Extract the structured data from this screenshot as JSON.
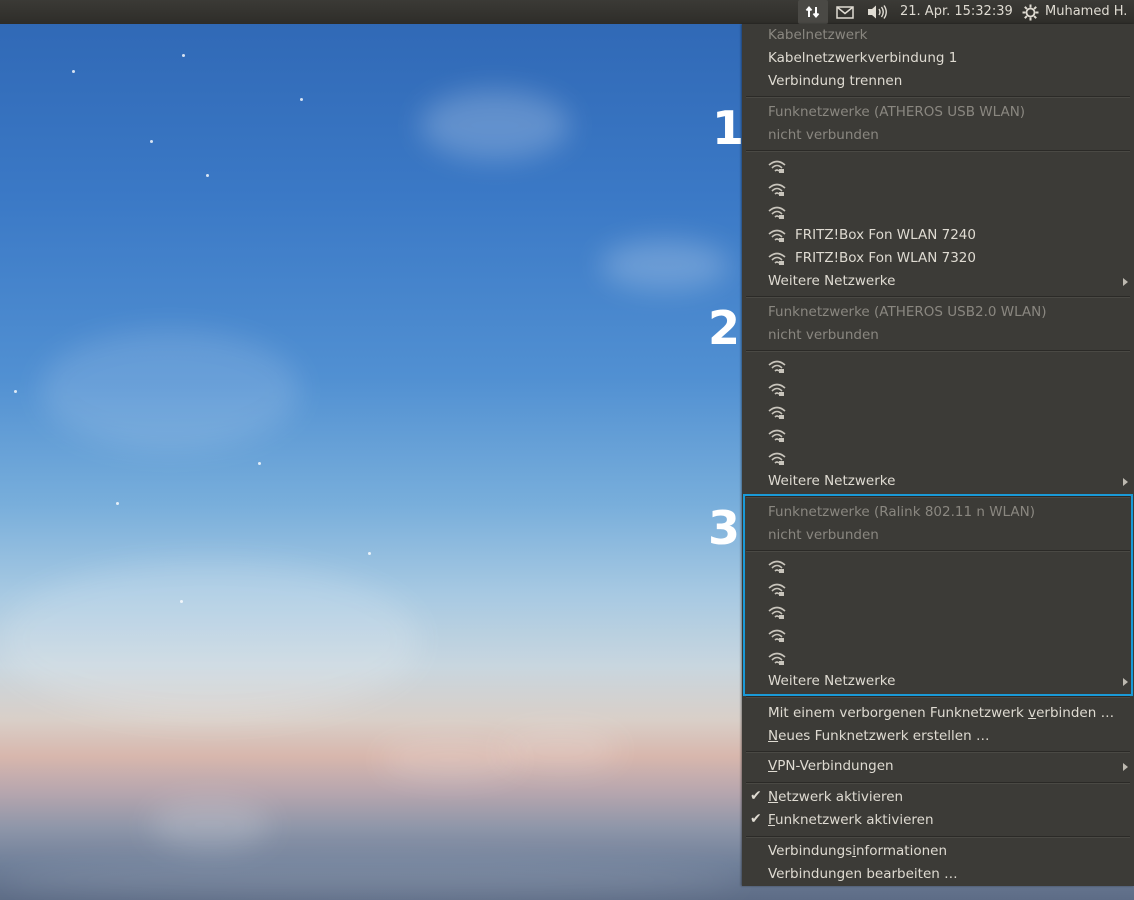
{
  "panel": {
    "clock": "21. Apr. 15:32:39",
    "user": "Muhamed H."
  },
  "annotations": [
    "1",
    "2",
    "3"
  ],
  "menu": {
    "wired": {
      "header": "Kabelnetzwerk",
      "connection": "Kabelnetzwerkverbindung 1",
      "disconnect": "Verbindung trennen"
    },
    "wifi1": {
      "header": "Funknetzwerke (ATHEROS USB WLAN)",
      "status": "nicht verbunden",
      "networks": [
        "",
        "",
        "",
        "FRITZ!Box Fon WLAN 7240",
        "FRITZ!Box Fon WLAN 7320"
      ],
      "more": "Weitere Netzwerke"
    },
    "wifi2": {
      "header": "Funknetzwerke (ATHEROS USB2.0 WLAN)",
      "status": "nicht verbunden",
      "networks": [
        "",
        "",
        "",
        "",
        ""
      ],
      "more": "Weitere Netzwerke"
    },
    "wifi3": {
      "header": "Funknetzwerke (Ralink 802.11 n WLAN)",
      "status": "nicht verbunden",
      "networks": [
        "",
        "",
        "",
        "",
        ""
      ],
      "more": "Weitere Netzwerke"
    },
    "hidden": {
      "pre": "Mit einem verborgenen Funknetzwerk ",
      "u": "v",
      "post": "erbinden …"
    },
    "create": {
      "u": "N",
      "post": "eues Funknetzwerk erstellen …"
    },
    "vpn": {
      "u": "V",
      "post": "PN-Verbindungen"
    },
    "enable_network": {
      "u": "N",
      "post": "etzwerk aktivieren"
    },
    "enable_wifi": {
      "u": "F",
      "post": "unknetzwerk aktivieren"
    },
    "info": {
      "pre": "Verbindungs",
      "u": "i",
      "post": "nformationen"
    },
    "edit": {
      "label": "Verbindungen bearbeiten …"
    }
  },
  "colors": {
    "menu_bg": "#3c3b37",
    "panel_bg": "#2e2d29",
    "highlight": "#1a9ad8",
    "text": "#dfdbd2",
    "disabled_text": "#8a8780"
  }
}
